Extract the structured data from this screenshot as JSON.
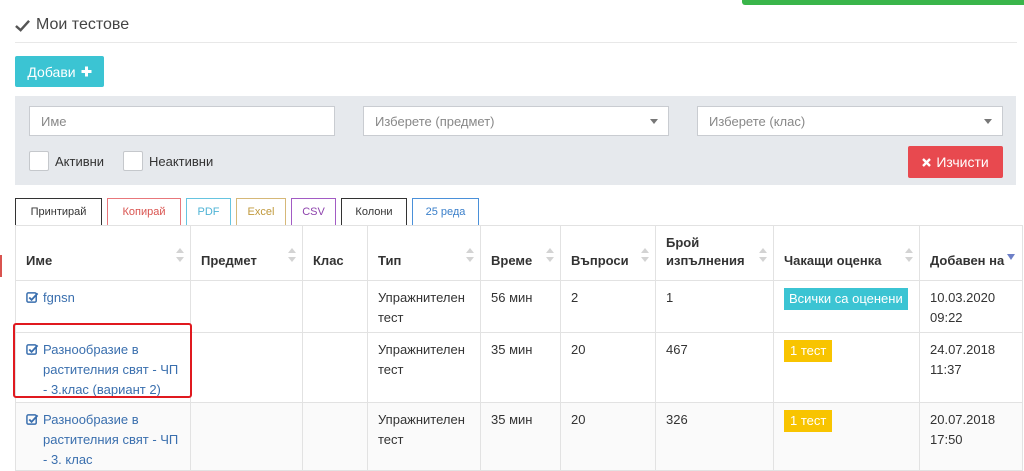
{
  "page": {
    "title": "Мои тестове"
  },
  "toolbar": {
    "add_label": "Добави"
  },
  "filters": {
    "name_placeholder": "Име",
    "subject_placeholder": "Изберете (предмет)",
    "class_placeholder": "Изберете (клас)",
    "active_label": "Активни",
    "inactive_label": "Неактивни",
    "clear_label": "Изчисти"
  },
  "export_buttons": {
    "print": "Принтирай",
    "copy": "Копирай",
    "pdf": "PDF",
    "excel": "Excel",
    "csv": "CSV",
    "columns": "Колони",
    "rows": "25 реда"
  },
  "table": {
    "headers": {
      "name": "Име",
      "subject": "Предмет",
      "class": "Клас",
      "type": "Тип",
      "time": "Време",
      "questions": "Въпроси",
      "attempts": "Брой изпълнения",
      "pending": "Чакащи оценка",
      "added": "Добавен на"
    },
    "rows": [
      {
        "name": "fgnsn",
        "subject": "",
        "class": "",
        "type": "Упражнителен тест",
        "time": "56 мин",
        "questions": "2",
        "attempts": "1",
        "pending": "Всички са оценени",
        "added": "10.03.2020 09:22"
      },
      {
        "name": "Разнообразие в растителния свят - ЧП - 3.клас (вариант 2)",
        "subject": "",
        "class": "",
        "type": "Упражнителен тест",
        "time": "35 мин",
        "questions": "20",
        "attempts": "467",
        "pending": "1 тест",
        "added": "24.07.2018 11:37"
      },
      {
        "name": "Разнообразие в растителния свят - ЧП - 3. клас",
        "subject": "",
        "class": "",
        "type": "Упражнителен тест",
        "time": "35 мин",
        "questions": "20",
        "attempts": "326",
        "pending": "1 тест",
        "added": "20.07.2018 17:50"
      }
    ]
  },
  "colors": {
    "accent": "#3bc4d3",
    "danger": "#e8494f",
    "warning": "#f8c400",
    "link": "#3a6fae",
    "highlight": "#e0191f"
  }
}
